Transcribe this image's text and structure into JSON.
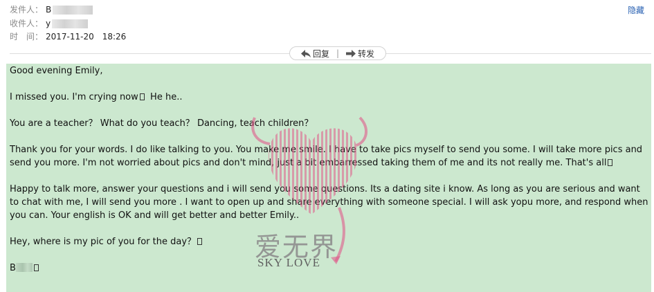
{
  "header": {
    "sender_label": "发件人：",
    "sender_value": "B",
    "recipient_label": "收件人：",
    "recipient_value": "y",
    "time_label": "时　间：",
    "time_value": "2017-11-20　18:26",
    "hide_label": "隐藏"
  },
  "actions": {
    "reply_label": "回复",
    "separator": "|",
    "forward_label": "转发"
  },
  "email": {
    "paragraphs": [
      "Good evening Emily,",
      "I missed you.  I'm crying now",
      "He he..",
      "You are a teacher？ What do you teach？ Dancing, teach children？",
      "Thank you for your words.  I do like talking to you.  You make me smile.  I have to take pics myself to send you some.  I will take more pics and send you more.  I'm not worried about pics and don't mind, just a bit embarressed taking them of me and its not really me.  That's all",
      "Happy to talk more, answer your questions and i will send you some questions.  Its a dating site i know.   As long as you are serious and want to chat with me, I will send you more .   I want to open up and share everything with someone special.  I will ask yopu more, and respond when you can.  Your english is OK and will get better and better Emily..",
      "Hey, where is my pic of you for the day？",
      "B"
    ]
  },
  "watermark": {
    "cn_text": "爱无界",
    "en_text": "SKY LOVE"
  },
  "colors": {
    "body_background": "#cce8cf",
    "link": "#2a62b3",
    "heart": "#e05a8a"
  }
}
